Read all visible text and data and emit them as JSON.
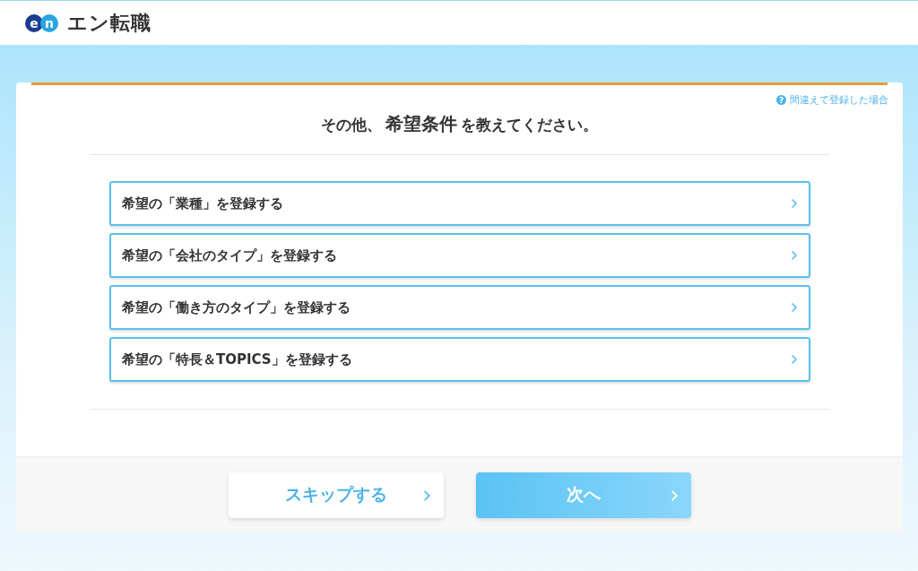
{
  "header": {
    "logo_letters": [
      "e",
      "n"
    ],
    "logo_text": "エン転職"
  },
  "help_link": "間違えて登録した場合",
  "help_icon": "?",
  "heading": {
    "before": "その他、",
    "emphasis": "希望条件",
    "after": "を教えてください。"
  },
  "options": [
    {
      "label": "希望の「業種」を登録する"
    },
    {
      "label": "希望の「会社のタイプ」を登録する"
    },
    {
      "label": "希望の「働き方のタイプ」を登録する"
    },
    {
      "label": "希望の「特長＆TOPICS」を登録する"
    }
  ],
  "buttons": {
    "skip": "スキップする",
    "next": "次へ"
  }
}
